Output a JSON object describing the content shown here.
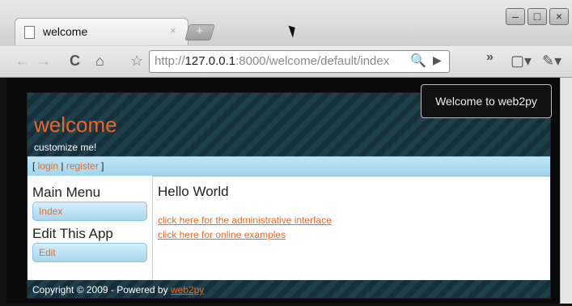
{
  "browser": {
    "tab_title": "welcome",
    "tab_close": "×",
    "new_tab": "+",
    "window_buttons": {
      "minimize": "–",
      "maximize": "□",
      "close": "×"
    },
    "nav": {
      "back": "←",
      "forward": "→",
      "reload": "C",
      "home": "⌂",
      "star": "☆",
      "chevrons": "»",
      "page": "▢▾",
      "wrench": "✎▾"
    },
    "url_prefix": "http://",
    "url_host": "127.0.0.1",
    "url_rest": ":8000/welcome/default/index",
    "url_search_icon": "🔍",
    "url_go_icon": "▶"
  },
  "page": {
    "app_name": "welcome",
    "subtitle": "customize me!",
    "welcome_box": "Welcome to web2py",
    "auth": {
      "open": "[ ",
      "login": "login",
      "sep": " | ",
      "register": "register",
      "close": " ]"
    },
    "sidebar": {
      "main_menu_title": "Main Menu",
      "main_menu_item": "Index",
      "edit_title": "Edit This App",
      "edit_item": "Edit"
    },
    "content": {
      "heading": "Hello World",
      "link_admin": "click here for the administrative interface",
      "link_examples": "click here for online examples"
    },
    "footer": {
      "text": "Copyright © 2009 - Powered by ",
      "brand": "web2py"
    }
  },
  "colors": {
    "accent": "#e86a2a",
    "header_bg": "#1f3f4a",
    "authbar_bg": "#bfe6f6"
  }
}
